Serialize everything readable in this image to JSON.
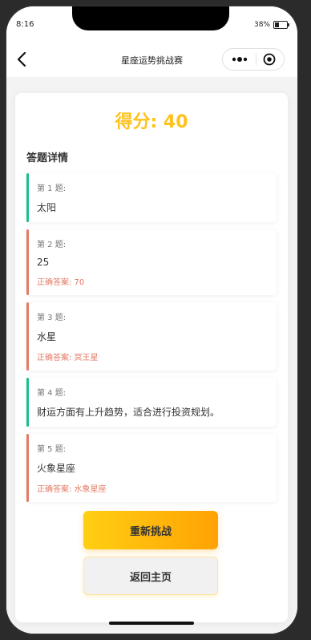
{
  "status": {
    "time": "8:16",
    "battery": "38%"
  },
  "nav": {
    "title": "星座运势挑战赛"
  },
  "score": "得分: 40",
  "section_title": "答题详情",
  "answers": [
    {
      "label": "第 1 题:",
      "answer": "太阳",
      "correct": "",
      "status": "correct",
      "bar_color": "#1bbf8f"
    },
    {
      "label": "第 2 题:",
      "answer": "25",
      "correct": "正确答案: 70",
      "status": "wrong",
      "bar_color": "#e37b66"
    },
    {
      "label": "第 3 题:",
      "answer": "水星",
      "correct": "正确答案: 冥王星",
      "status": "wrong",
      "bar_color": "#e37b66"
    },
    {
      "label": "第 4 题:",
      "answer": "财运方面有上升趋势，适合进行投资规划。",
      "correct": "",
      "status": "correct",
      "bar_color": "#1bbf8f"
    },
    {
      "label": "第 5 题:",
      "answer": "火象星座",
      "correct": "正确答案: 水象星座",
      "status": "wrong",
      "bar_color": "#e37b66"
    }
  ],
  "buttons": {
    "retry": "重新挑战",
    "home": "返回主页"
  },
  "icons": {
    "back": "back-arrow-icon",
    "more": "more-dots-icon",
    "close": "target-icon"
  },
  "colors": {
    "accent": "#ffc21c",
    "correct": "#1bbf8f",
    "wrong": "#e37b66"
  }
}
